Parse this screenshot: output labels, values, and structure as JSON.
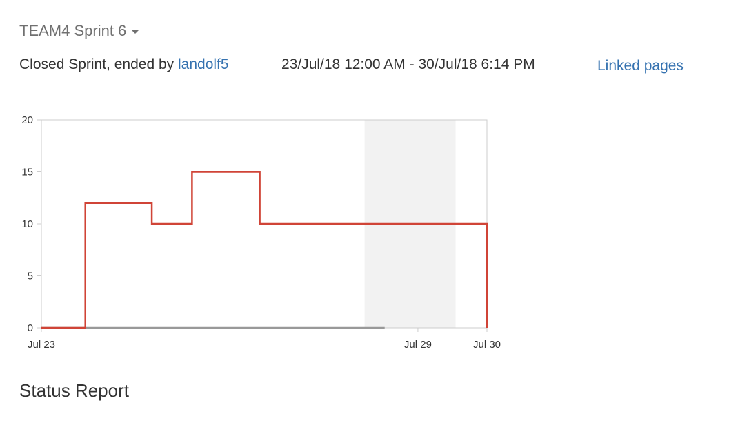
{
  "sprint_selector": {
    "label": "TEAM4 Sprint 6",
    "icon": "caret-down-icon"
  },
  "sprint_info": {
    "status_prefix": "Closed Sprint, ended by ",
    "ended_by": "landolf5",
    "date_range": "23/Jul/18 12:00 AM - 30/Jul/18 6:14 PM",
    "linked_pages_label": "Linked pages"
  },
  "chart_data": {
    "type": "line",
    "title": "",
    "xlabel": "",
    "ylabel": "",
    "x_tick_labels": [
      {
        "day": 0,
        "label": "Jul 23"
      },
      {
        "day": 6,
        "label": "Jul 29"
      },
      {
        "day": 7.1,
        "label": "Jul 30"
      }
    ],
    "x_range_days": [
      0,
      7.1
    ],
    "ylim": [
      0,
      20
    ],
    "y_ticks": [
      0,
      5,
      10,
      15,
      20
    ],
    "non_working_period_days": [
      5.15,
      6.6
    ],
    "series": [
      {
        "style": "step",
        "color": "#d04437",
        "points": [
          {
            "x": 0,
            "y": 0
          },
          {
            "x": 0.7,
            "y": 0
          },
          {
            "x": 0.7,
            "y": 12
          },
          {
            "x": 1.76,
            "y": 12
          },
          {
            "x": 1.76,
            "y": 10
          },
          {
            "x": 2.4,
            "y": 10
          },
          {
            "x": 2.4,
            "y": 15
          },
          {
            "x": 3.48,
            "y": 15
          },
          {
            "x": 3.48,
            "y": 10
          },
          {
            "x": 7.1,
            "y": 10
          },
          {
            "x": 7.1,
            "y": 0
          }
        ]
      },
      {
        "style": "line",
        "color": "#999999",
        "points": [
          {
            "x": 0,
            "y": 0
          },
          {
            "x": 5.47,
            "y": 0
          }
        ]
      }
    ],
    "plot_border_color": "#cccccc",
    "non_working_fill": "#f2f2f2"
  },
  "status_report": {
    "heading": "Status Report"
  }
}
